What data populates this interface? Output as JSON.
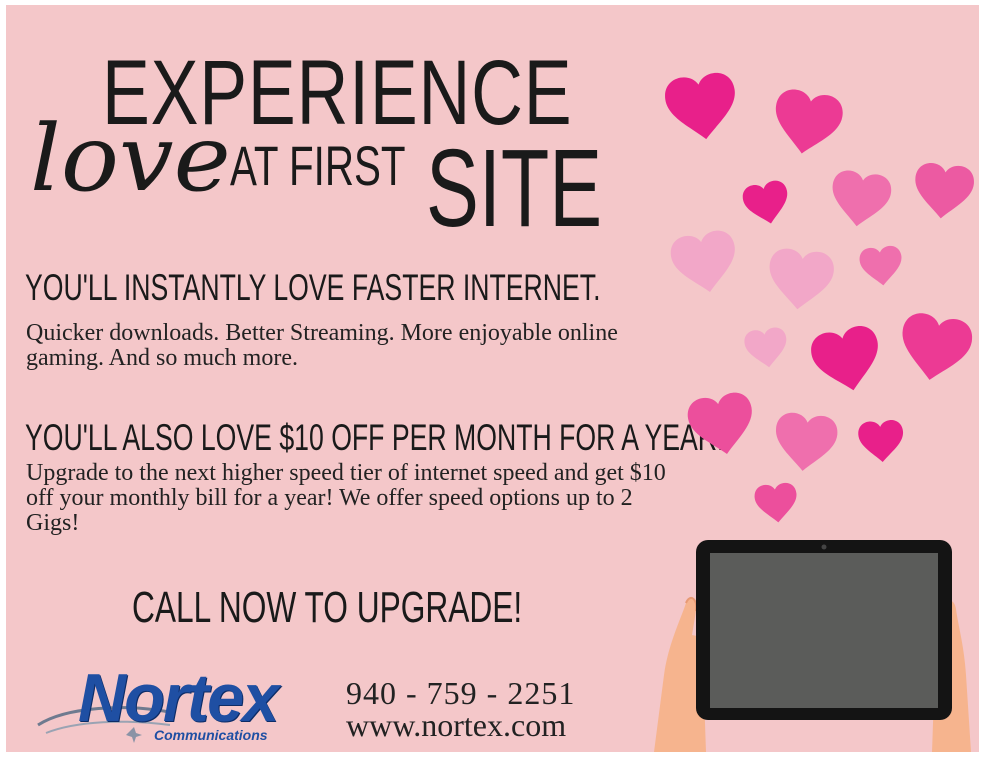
{
  "headline": {
    "line1": "EXPERIENCE",
    "love": "love",
    "at_first": "AT FIRST",
    "site": "SITE"
  },
  "section1": {
    "heading": "YOU'LL INSTANTLY LOVE FASTER INTERNET.",
    "body": "Quicker downloads. Better Streaming. More enjoyable online gaming. And so much more."
  },
  "section2": {
    "heading": "YOU'LL ALSO LOVE $10 OFF PER MONTH FOR A YEAR!",
    "body": "Upgrade to the next higher speed tier of internet speed and get $10 off your monthly bill for a year! We offer speed options up to 2 Gigs!"
  },
  "cta": "CALL NOW TO UPGRADE!",
  "brand": {
    "name": "Nortex",
    "tagline": "Communications"
  },
  "contact": {
    "phone": "940 - 759 - 2251",
    "website": "www.nortex.com"
  },
  "colors": {
    "background": "#f4c7c9",
    "heart_dark": "#e8208a",
    "heart_mid": "#ef6fad",
    "heart_light": "#f2a7c8",
    "logo_blue": "#1f4fa3"
  }
}
